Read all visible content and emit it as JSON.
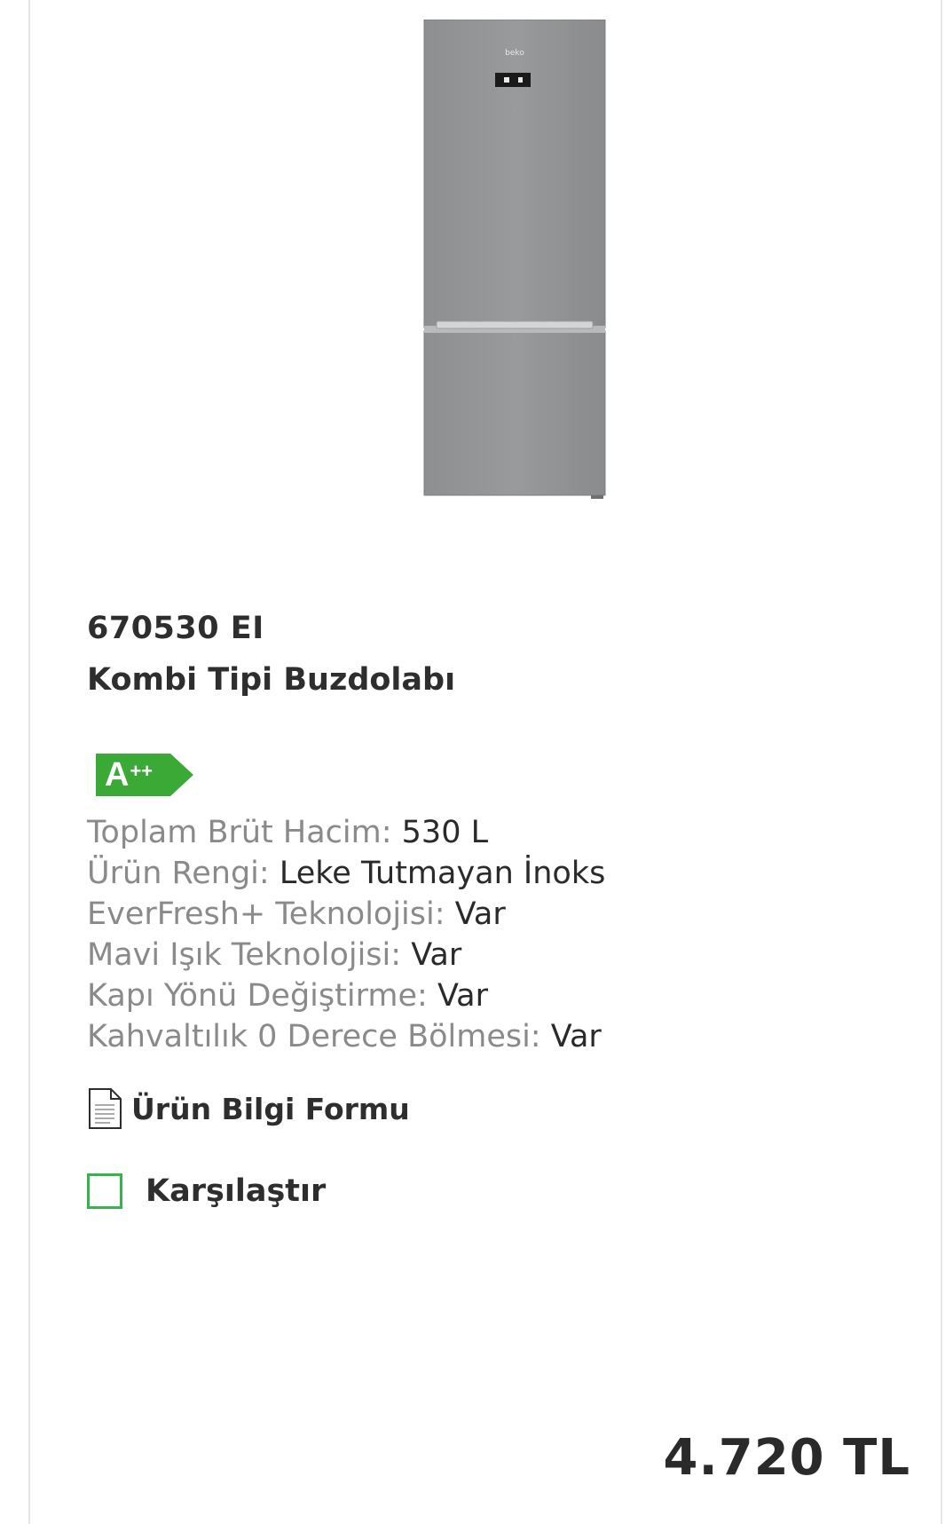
{
  "product": {
    "model_code": "670530 EI",
    "type": "Kombi Tipi Buzdolabı",
    "image_brand_text": "beko",
    "energy_class": {
      "letter": "A",
      "plus": "++",
      "color": "#3aa935"
    },
    "specs": [
      {
        "label": "Toplam Brüt Hacim:",
        "value": "530 L"
      },
      {
        "label": "Ürün Rengi:",
        "value": "Leke Tutmayan İnoks"
      },
      {
        "label": "EverFresh+ Teknolojisi:",
        "value": "Var"
      },
      {
        "label": "Mavi Işık Teknolojisi:",
        "value": "Var"
      },
      {
        "label": "Kapı Yönü Değiştirme:",
        "value": "Var"
      },
      {
        "label": "Kahvaltılık 0 Derece Bölmesi:",
        "value": "Var"
      }
    ],
    "info_form_label": "Ürün Bilgi Formu",
    "compare_label": "Karşılaştır",
    "price": "4.720 TL"
  },
  "colors": {
    "accent_green": "#37b24d",
    "label_gray": "#8a8a8a",
    "text_dark": "#2a2a2a"
  }
}
